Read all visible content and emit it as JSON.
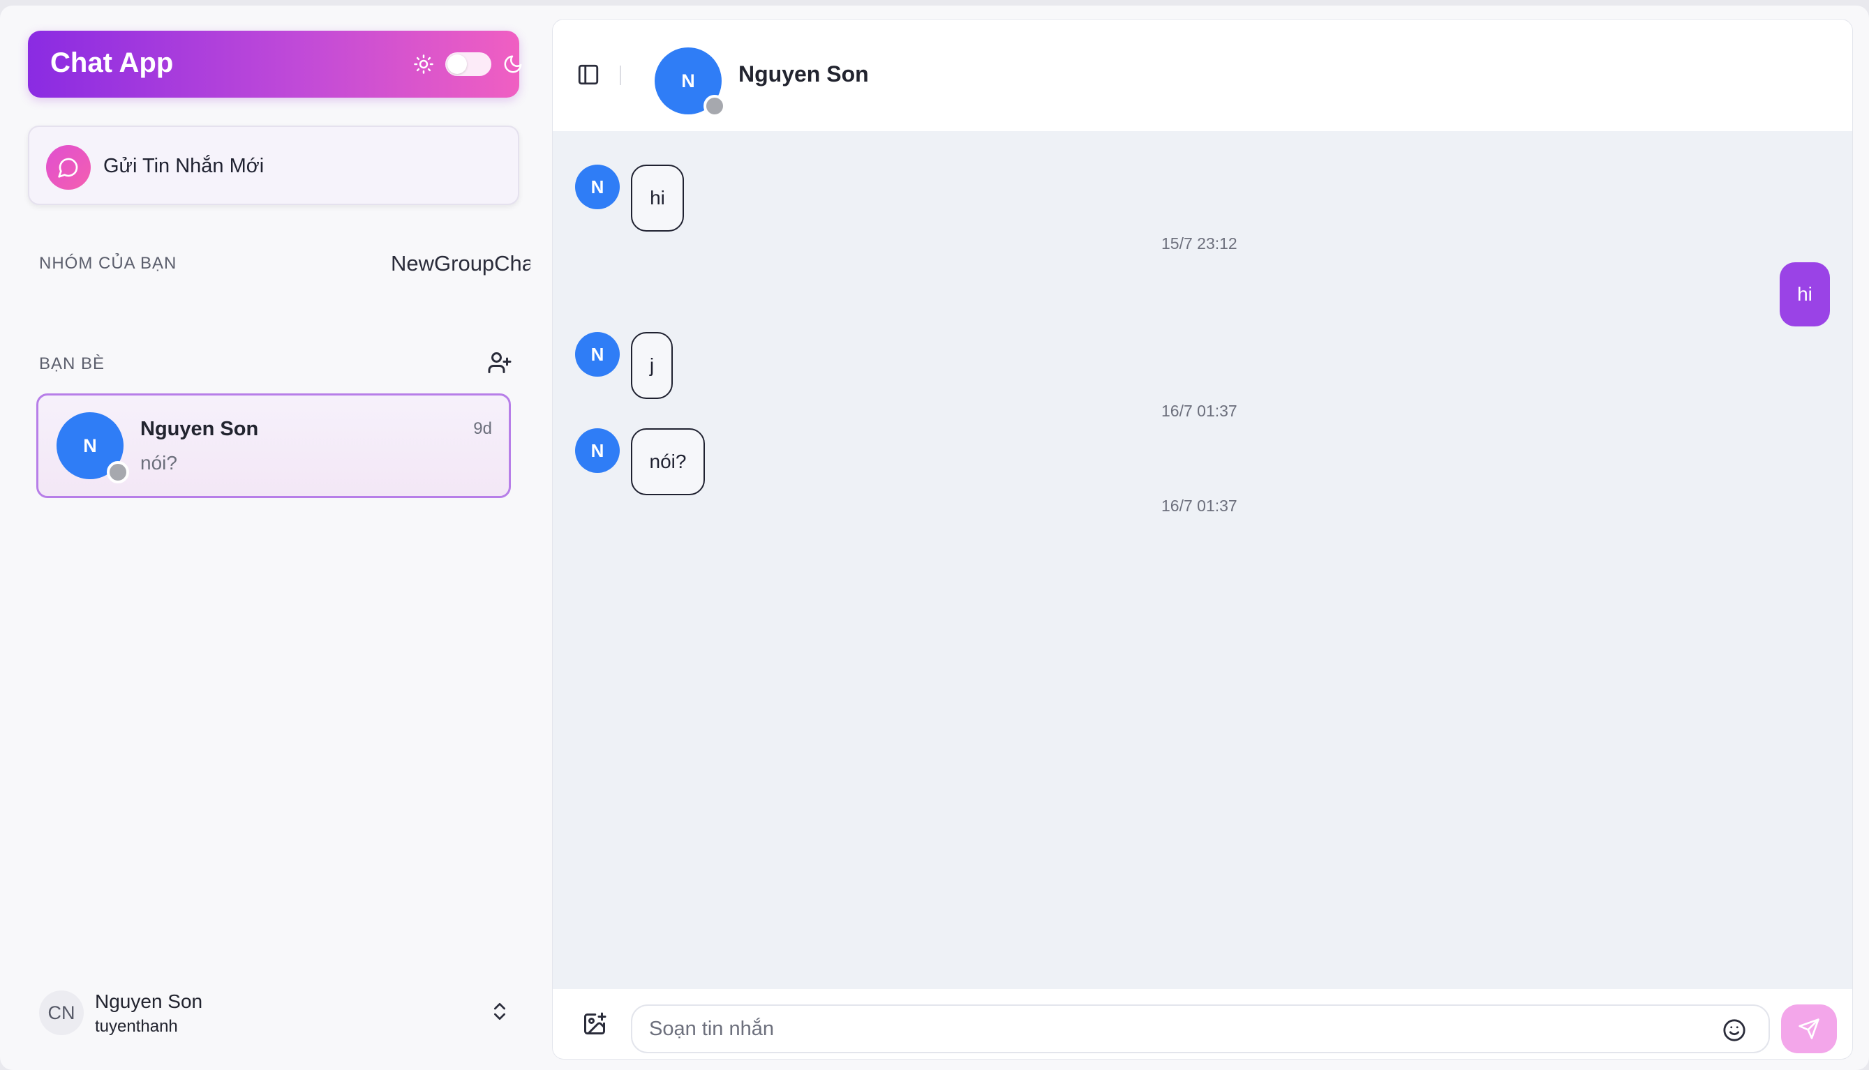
{
  "brand": {
    "title": "Chat App",
    "theme": "light"
  },
  "new_message": {
    "label": "Gửi Tin Nhắn Mới"
  },
  "groups": {
    "heading": "NHÓM CỦA BẠN",
    "items": [
      "NewGroupChat"
    ]
  },
  "friends": {
    "heading": "BẠN BÈ",
    "items": [
      {
        "initial": "N",
        "name": "Nguyen Son",
        "time": "9d",
        "last_message": "nói?",
        "status": "offline"
      }
    ]
  },
  "current_user": {
    "initials": "CN",
    "name": "Nguyen Son",
    "handle": "tuyenthanh"
  },
  "chat": {
    "contact_initial": "N",
    "contact_name": "Nguyen Son",
    "messages": [
      {
        "direction": "in",
        "initial": "N",
        "text": "hi",
        "time": "15/7 23:12"
      },
      {
        "direction": "out",
        "text": "hi"
      },
      {
        "direction": "in",
        "initial": "N",
        "text": "j",
        "time": "16/7 01:37"
      },
      {
        "direction": "in",
        "initial": "N",
        "text": "nói?",
        "time": "16/7 01:37"
      }
    ]
  },
  "composer": {
    "placeholder": "Soạn tin nhắn",
    "value": ""
  },
  "colors": {
    "accent": "#9a43e6",
    "brand_gradient_start": "#8a2be2",
    "brand_gradient_end": "#f05fc2",
    "avatar": "#2f7df6",
    "send_button": "#f3a6ea",
    "offline_dot": "#a6a8ae"
  },
  "icons": [
    "sun-icon",
    "moon-icon",
    "chat-bubble-icon",
    "add-user-icon",
    "chevrons-up-down-icon",
    "sidebar-panel-icon",
    "image-add-icon",
    "emoji-icon",
    "send-icon"
  ]
}
